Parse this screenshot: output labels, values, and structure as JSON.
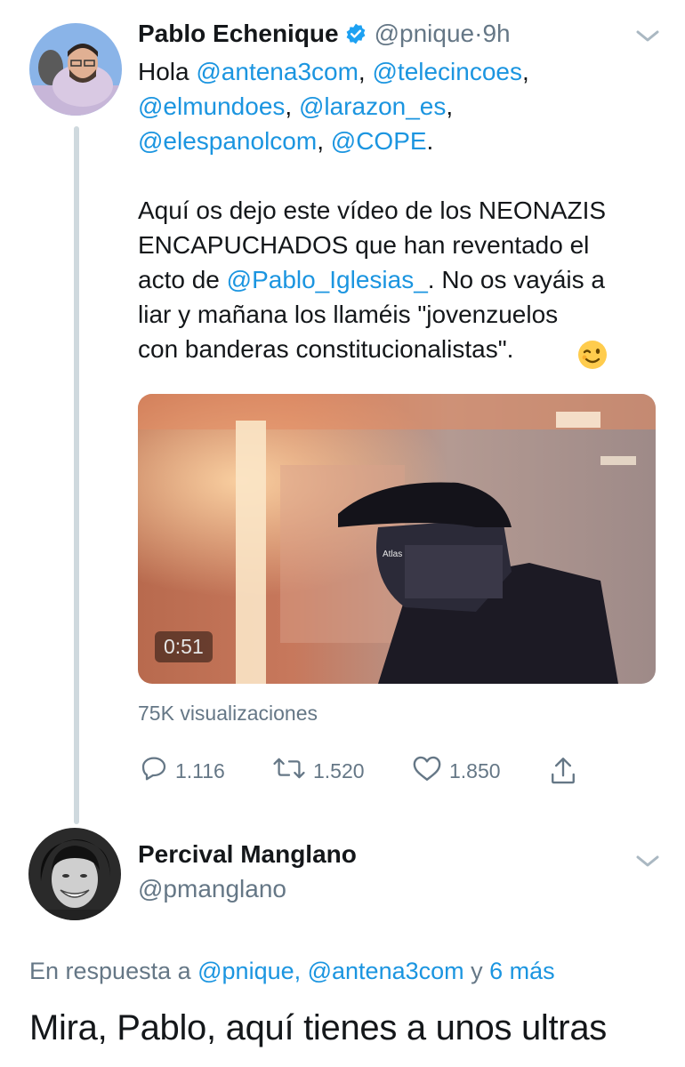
{
  "tweet": {
    "author_name": "Pablo Echenique",
    "handle": "@pnique",
    "separator": " · ",
    "time": "9h",
    "lines": [
      {
        "parts": [
          {
            "t": "Hola ",
            "m": false
          },
          {
            "t": "@antena3com",
            "m": true
          },
          {
            "t": ", ",
            "m": false
          },
          {
            "t": "@telecincoes",
            "m": true
          },
          {
            "t": ",",
            "m": false
          }
        ]
      },
      {
        "parts": [
          {
            "t": "@elmundoes",
            "m": true
          },
          {
            "t": ", ",
            "m": false
          },
          {
            "t": "@larazon_es",
            "m": true
          },
          {
            "t": ",",
            "m": false
          }
        ]
      },
      {
        "parts": [
          {
            "t": "@elespanolcom",
            "m": true
          },
          {
            "t": ", ",
            "m": false
          },
          {
            "t": "@COPE",
            "m": true
          },
          {
            "t": ".",
            "m": false
          }
        ]
      },
      {
        "parts": []
      },
      {
        "parts": [
          {
            "t": "Aquí os dejo este vídeo de los NEONAZIS",
            "m": false
          }
        ]
      },
      {
        "parts": [
          {
            "t": "ENCAPUCHADOS que han reventado el",
            "m": false
          }
        ]
      },
      {
        "parts": [
          {
            "t": "acto de ",
            "m": false
          },
          {
            "t": "@Pablo_Iglesias_",
            "m": true
          },
          {
            "t": ". No os vayáis a",
            "m": false
          }
        ]
      },
      {
        "parts": [
          {
            "t": "liar y mañana los llaméis \"jovenzuelos",
            "m": false
          }
        ]
      },
      {
        "parts": [
          {
            "t": "con banderas constitucionalistas\".",
            "m": false
          }
        ]
      }
    ],
    "video_cap_text": "Atlas",
    "video_duration": "0:51",
    "views": "75K visualizaciones",
    "replies": "1.116",
    "retweets": "1.520",
    "likes": "1.850"
  },
  "reply": {
    "author_name": "Percival Manglano",
    "handle": "@pmanglano",
    "in_reply_prefix": "En respuesta a ",
    "in_reply_mentions": "@pnique, @antena3com",
    "in_reply_join": " y ",
    "in_reply_more": "6 más",
    "text": "Mira, Pablo, aquí tienes a unos ultras"
  },
  "colors": {
    "link": "#1b95e0",
    "secondary": "#657786",
    "verified": "#1da1f2"
  },
  "icons": [
    "verified-badge-icon",
    "chevron-down-icon",
    "reply-icon",
    "retweet-icon",
    "like-icon",
    "share-icon",
    "wink-emoji-icon"
  ]
}
